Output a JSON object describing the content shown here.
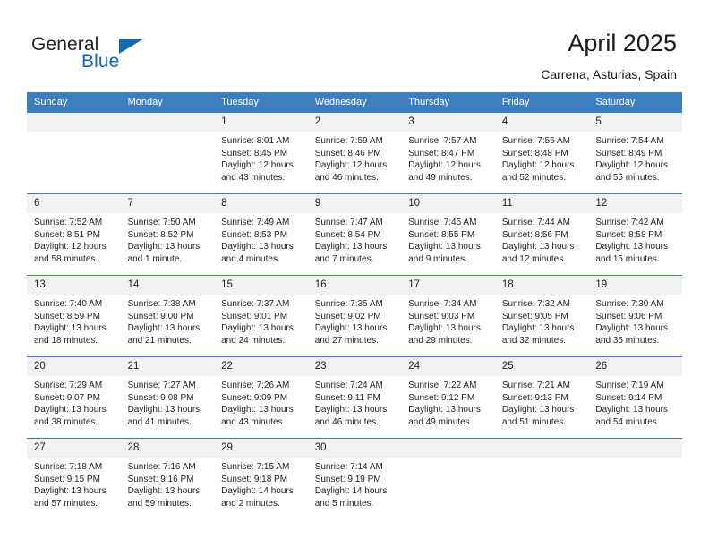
{
  "brand": {
    "name_part1": "General",
    "name_part2": "Blue",
    "logo_icon": "triangle-flag-icon",
    "accent_color": "#1268b3"
  },
  "header": {
    "title": "April 2025",
    "subtitle": "Carrena, Asturias, Spain"
  },
  "calendar": {
    "header_bg": "#3c7fc1",
    "daynum_bg": "#f2f2f2",
    "weekday_headers": [
      "Sunday",
      "Monday",
      "Tuesday",
      "Wednesday",
      "Thursday",
      "Friday",
      "Saturday"
    ],
    "weeks": [
      [
        {
          "day": "",
          "empty": true,
          "sunrise": "",
          "sunset": "",
          "daylight_line1": "",
          "daylight_line2": ""
        },
        {
          "day": "",
          "empty": true,
          "sunrise": "",
          "sunset": "",
          "daylight_line1": "",
          "daylight_line2": ""
        },
        {
          "day": "1",
          "empty": false,
          "sunrise": "Sunrise: 8:01 AM",
          "sunset": "Sunset: 8:45 PM",
          "daylight_line1": "Daylight: 12 hours",
          "daylight_line2": "and 43 minutes."
        },
        {
          "day": "2",
          "empty": false,
          "sunrise": "Sunrise: 7:59 AM",
          "sunset": "Sunset: 8:46 PM",
          "daylight_line1": "Daylight: 12 hours",
          "daylight_line2": "and 46 minutes."
        },
        {
          "day": "3",
          "empty": false,
          "sunrise": "Sunrise: 7:57 AM",
          "sunset": "Sunset: 8:47 PM",
          "daylight_line1": "Daylight: 12 hours",
          "daylight_line2": "and 49 minutes."
        },
        {
          "day": "4",
          "empty": false,
          "sunrise": "Sunrise: 7:56 AM",
          "sunset": "Sunset: 8:48 PM",
          "daylight_line1": "Daylight: 12 hours",
          "daylight_line2": "and 52 minutes."
        },
        {
          "day": "5",
          "empty": false,
          "sunrise": "Sunrise: 7:54 AM",
          "sunset": "Sunset: 8:49 PM",
          "daylight_line1": "Daylight: 12 hours",
          "daylight_line2": "and 55 minutes."
        }
      ],
      [
        {
          "day": "6",
          "empty": false,
          "sunrise": "Sunrise: 7:52 AM",
          "sunset": "Sunset: 8:51 PM",
          "daylight_line1": "Daylight: 12 hours",
          "daylight_line2": "and 58 minutes."
        },
        {
          "day": "7",
          "empty": false,
          "sunrise": "Sunrise: 7:50 AM",
          "sunset": "Sunset: 8:52 PM",
          "daylight_line1": "Daylight: 13 hours",
          "daylight_line2": "and 1 minute."
        },
        {
          "day": "8",
          "empty": false,
          "sunrise": "Sunrise: 7:49 AM",
          "sunset": "Sunset: 8:53 PM",
          "daylight_line1": "Daylight: 13 hours",
          "daylight_line2": "and 4 minutes."
        },
        {
          "day": "9",
          "empty": false,
          "sunrise": "Sunrise: 7:47 AM",
          "sunset": "Sunset: 8:54 PM",
          "daylight_line1": "Daylight: 13 hours",
          "daylight_line2": "and 7 minutes."
        },
        {
          "day": "10",
          "empty": false,
          "sunrise": "Sunrise: 7:45 AM",
          "sunset": "Sunset: 8:55 PM",
          "daylight_line1": "Daylight: 13 hours",
          "daylight_line2": "and 9 minutes."
        },
        {
          "day": "11",
          "empty": false,
          "sunrise": "Sunrise: 7:44 AM",
          "sunset": "Sunset: 8:56 PM",
          "daylight_line1": "Daylight: 13 hours",
          "daylight_line2": "and 12 minutes."
        },
        {
          "day": "12",
          "empty": false,
          "sunrise": "Sunrise: 7:42 AM",
          "sunset": "Sunset: 8:58 PM",
          "daylight_line1": "Daylight: 13 hours",
          "daylight_line2": "and 15 minutes."
        }
      ],
      [
        {
          "day": "13",
          "empty": false,
          "sunrise": "Sunrise: 7:40 AM",
          "sunset": "Sunset: 8:59 PM",
          "daylight_line1": "Daylight: 13 hours",
          "daylight_line2": "and 18 minutes."
        },
        {
          "day": "14",
          "empty": false,
          "sunrise": "Sunrise: 7:38 AM",
          "sunset": "Sunset: 9:00 PM",
          "daylight_line1": "Daylight: 13 hours",
          "daylight_line2": "and 21 minutes."
        },
        {
          "day": "15",
          "empty": false,
          "sunrise": "Sunrise: 7:37 AM",
          "sunset": "Sunset: 9:01 PM",
          "daylight_line1": "Daylight: 13 hours",
          "daylight_line2": "and 24 minutes."
        },
        {
          "day": "16",
          "empty": false,
          "sunrise": "Sunrise: 7:35 AM",
          "sunset": "Sunset: 9:02 PM",
          "daylight_line1": "Daylight: 13 hours",
          "daylight_line2": "and 27 minutes."
        },
        {
          "day": "17",
          "empty": false,
          "sunrise": "Sunrise: 7:34 AM",
          "sunset": "Sunset: 9:03 PM",
          "daylight_line1": "Daylight: 13 hours",
          "daylight_line2": "and 29 minutes."
        },
        {
          "day": "18",
          "empty": false,
          "sunrise": "Sunrise: 7:32 AM",
          "sunset": "Sunset: 9:05 PM",
          "daylight_line1": "Daylight: 13 hours",
          "daylight_line2": "and 32 minutes."
        },
        {
          "day": "19",
          "empty": false,
          "sunrise": "Sunrise: 7:30 AM",
          "sunset": "Sunset: 9:06 PM",
          "daylight_line1": "Daylight: 13 hours",
          "daylight_line2": "and 35 minutes."
        }
      ],
      [
        {
          "day": "20",
          "empty": false,
          "sunrise": "Sunrise: 7:29 AM",
          "sunset": "Sunset: 9:07 PM",
          "daylight_line1": "Daylight: 13 hours",
          "daylight_line2": "and 38 minutes."
        },
        {
          "day": "21",
          "empty": false,
          "sunrise": "Sunrise: 7:27 AM",
          "sunset": "Sunset: 9:08 PM",
          "daylight_line1": "Daylight: 13 hours",
          "daylight_line2": "and 41 minutes."
        },
        {
          "day": "22",
          "empty": false,
          "sunrise": "Sunrise: 7:26 AM",
          "sunset": "Sunset: 9:09 PM",
          "daylight_line1": "Daylight: 13 hours",
          "daylight_line2": "and 43 minutes."
        },
        {
          "day": "23",
          "empty": false,
          "sunrise": "Sunrise: 7:24 AM",
          "sunset": "Sunset: 9:11 PM",
          "daylight_line1": "Daylight: 13 hours",
          "daylight_line2": "and 46 minutes."
        },
        {
          "day": "24",
          "empty": false,
          "sunrise": "Sunrise: 7:22 AM",
          "sunset": "Sunset: 9:12 PM",
          "daylight_line1": "Daylight: 13 hours",
          "daylight_line2": "and 49 minutes."
        },
        {
          "day": "25",
          "empty": false,
          "sunrise": "Sunrise: 7:21 AM",
          "sunset": "Sunset: 9:13 PM",
          "daylight_line1": "Daylight: 13 hours",
          "daylight_line2": "and 51 minutes."
        },
        {
          "day": "26",
          "empty": false,
          "sunrise": "Sunrise: 7:19 AM",
          "sunset": "Sunset: 9:14 PM",
          "daylight_line1": "Daylight: 13 hours",
          "daylight_line2": "and 54 minutes."
        }
      ],
      [
        {
          "day": "27",
          "empty": false,
          "sunrise": "Sunrise: 7:18 AM",
          "sunset": "Sunset: 9:15 PM",
          "daylight_line1": "Daylight: 13 hours",
          "daylight_line2": "and 57 minutes."
        },
        {
          "day": "28",
          "empty": false,
          "sunrise": "Sunrise: 7:16 AM",
          "sunset": "Sunset: 9:16 PM",
          "daylight_line1": "Daylight: 13 hours",
          "daylight_line2": "and 59 minutes."
        },
        {
          "day": "29",
          "empty": false,
          "sunrise": "Sunrise: 7:15 AM",
          "sunset": "Sunset: 9:18 PM",
          "daylight_line1": "Daylight: 14 hours",
          "daylight_line2": "and 2 minutes."
        },
        {
          "day": "30",
          "empty": false,
          "sunrise": "Sunrise: 7:14 AM",
          "sunset": "Sunset: 9:19 PM",
          "daylight_line1": "Daylight: 14 hours",
          "daylight_line2": "and 5 minutes."
        },
        {
          "day": "",
          "empty": true,
          "sunrise": "",
          "sunset": "",
          "daylight_line1": "",
          "daylight_line2": ""
        },
        {
          "day": "",
          "empty": true,
          "sunrise": "",
          "sunset": "",
          "daylight_line1": "",
          "daylight_line2": ""
        },
        {
          "day": "",
          "empty": true,
          "sunrise": "",
          "sunset": "",
          "daylight_line1": "",
          "daylight_line2": ""
        }
      ]
    ]
  }
}
